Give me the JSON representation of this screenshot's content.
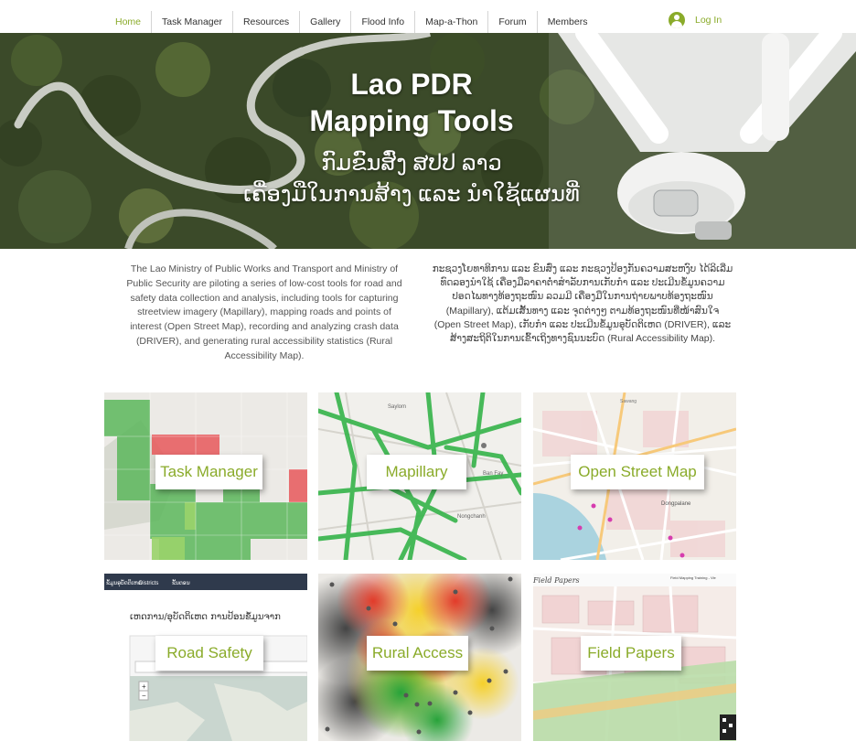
{
  "nav": {
    "items": [
      "Home",
      "Task Manager",
      "Resources",
      "Gallery",
      "Flood Info",
      "Map-a-Thon",
      "Forum",
      "Members"
    ],
    "active_index": 0,
    "login_label": "Log In"
  },
  "hero": {
    "title_line1": "Lao PDR",
    "title_line2": "Mapping Tools",
    "lao_line1": "ກົມຂົນສົ່ງ ສປປ ລາວ",
    "lao_line2": "ເຄື່ອງມືໃນການສ້າງ ແລະ ນຳໃຊ້ແຜນທີ່"
  },
  "intro": {
    "english": "The Lao Ministry of Public Works and Transport and Ministry of Public Security are piloting a series of low-cost tools for road and safety data collection and analysis, including tools for capturing streetview imagery (Mapillary), mapping roads and points of interest (Open Street Map), recording and analyzing crash data (DRIVER), and generating rural accessibility statistics (Rural Accessibility Map).",
    "lao": "ກະຊວງໂຍທາທິການ ແລະ ຂົນສົ່ງ ແລະ ກະຊວງປ້ອງກັນຄວາມສະຫງົບ ໄດ້ລິເລີ່ມທົດລອງນຳໃຊ້ ເຄື່ອງມືລາຄາຕ່ຳສຳລັບການເກັບກຳ ແລະ ປະເມີນຂໍ້ມູນຄວາມປອດໄພທາງທ້ອງຖະໜົນ ລວມມີ ເຄື່ອງມືໃນການຖ່າຍພາບທ້ອງຖະໜົນ (Mapillary), ແຕ້ມເສັ້ນທາງ ແລະ ຈຸດຕ່າງໆ ຕາມທ້ອງຖະໜົນທີ່ໜ້າສົນໃຈ (Open Street Map), ເກັບກຳ ແລະ ປະເມີນຂໍ້ມູນອຸບັດຕິເຫດ (DRIVER), ແລະ ສ້າງສະຖິຕິໃນການເຂົ້າເຖິງທາງຊົນນະບົດ (Rural Accessibility Map)."
  },
  "tiles": [
    {
      "label": "Task Manager"
    },
    {
      "label": "Mapillary",
      "map_labels": [
        "Saylom",
        "Ban Fay",
        "Nongchanh"
      ]
    },
    {
      "label": "Open Street Map",
      "map_labels": [
        "Sawang",
        "Dongpalane"
      ]
    },
    {
      "label": "Road Safety",
      "menu": [
        "ຂໍ້ມູນອຸບັດຕິເຫດ",
        "Districts",
        "ຂັ້ນຕອນ"
      ],
      "heading": "ເຫດການ/ອຸບັດຕິເຫດ ການປ້ອນຂໍ້ມູນຈາກ",
      "zoom": [
        "+",
        "−"
      ]
    },
    {
      "label": "Rural Access"
    },
    {
      "label": "Field Papers",
      "header": "Field Papers",
      "sheet_title": "Field Mapping Training - Vie"
    }
  ],
  "colors": {
    "accent": "#8aab2a",
    "task_green": "#5cb85c",
    "task_red": "#e8585a",
    "mapillary_green": "#35b44a"
  }
}
